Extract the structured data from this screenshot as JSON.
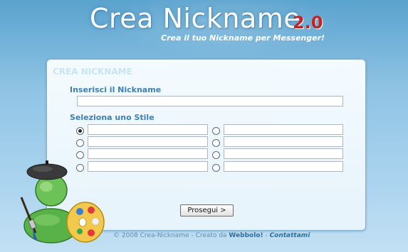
{
  "header": {
    "title": "Crea Nickname",
    "version": "2.0",
    "subtitle": "Crea il tuo Nickname per Messenger!"
  },
  "form": {
    "panel_title": "CREA NICKNAME",
    "nickname_label": "Inserisci il Nickname",
    "nickname_value": "",
    "style_label": "Seleziona uno Stile",
    "styles_left": [
      "",
      "",
      "",
      ""
    ],
    "styles_right": [
      "",
      "",
      "",
      ""
    ],
    "selected_style": 0,
    "submit_label": "Prosegui >"
  },
  "footer": {
    "copyright": "© 2008 Crea-Nickname - Creato da ",
    "author_link": "Webbolo!",
    "separator": " - ",
    "contact_link": "Contattami"
  },
  "colors": {
    "background_top": "#5aa3cf",
    "label_blue": "#3c7fb3",
    "version_red": "#c52222"
  },
  "icons": {
    "mascot": "messenger-painter-mascot-icon"
  }
}
